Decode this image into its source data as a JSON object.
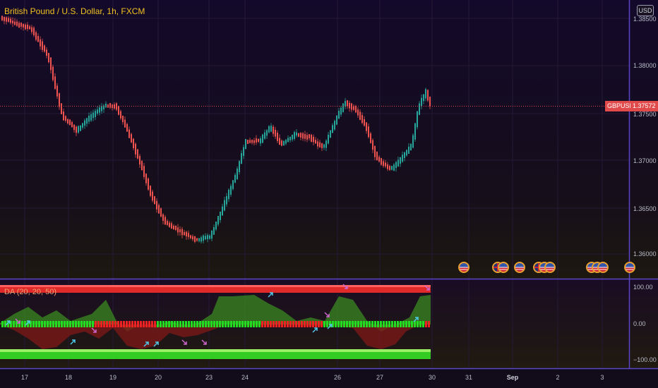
{
  "header": {
    "title": "British Pound / U.S. Dollar, 1h, FXCM",
    "currency_badge": "USD"
  },
  "price_axis": {
    "labels": [
      "1.38500",
      "1.38000",
      "1.37500",
      "1.37000",
      "1.36500",
      "1.36000"
    ],
    "symbol_tag": "GBPUSD",
    "last_price": "1.37572"
  },
  "indicator": {
    "label": "DA (20, 20, 50)",
    "axis_labels": [
      "100.00",
      "0.00",
      "−100.00"
    ]
  },
  "time_axis": {
    "labels": [
      "17",
      "18",
      "19",
      "20",
      "23",
      "24",
      "26",
      "27",
      "30",
      "31",
      "Sep",
      "2",
      "3"
    ]
  },
  "events": {
    "flags": [
      "us",
      "us",
      "gb",
      "us",
      "gb",
      "us",
      "us",
      "gb"
    ]
  },
  "colors": {
    "background": "#120c1a",
    "up_candle": "#26a69a",
    "down_candle": "#ef5350",
    "accent": "#f0c020",
    "grid": "#2a2040",
    "separator": "#5a44c8",
    "last_price": "#e04a4a"
  }
}
